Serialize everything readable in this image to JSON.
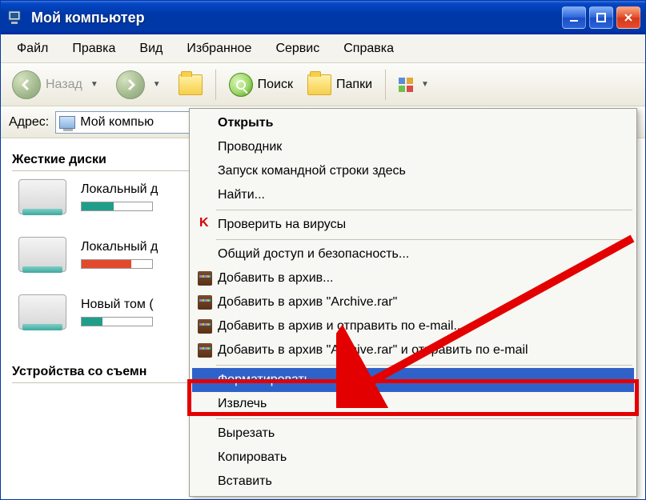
{
  "window": {
    "title": "Мой компьютер"
  },
  "menubar": [
    "Файл",
    "Правка",
    "Вид",
    "Избранное",
    "Сервис",
    "Справка"
  ],
  "toolbar": {
    "back_label": "Назад",
    "search_label": "Поиск",
    "folders_label": "Папки"
  },
  "addressbar": {
    "label": "Адрес:",
    "value": "Мой компью"
  },
  "content": {
    "section_hdd": "Жесткие диски",
    "section_removable": "Устройства со съемн",
    "drives": [
      {
        "label": "Локальный д",
        "fill_pct": 45,
        "fill_color": "#1f9e8a"
      },
      {
        "label": "Локальный д",
        "fill_pct": 70,
        "fill_color": "#e24a2b"
      },
      {
        "label": "Новый том (",
        "fill_pct": 30,
        "fill_color": "#1f9e8a"
      }
    ]
  },
  "context_menu": {
    "groups": [
      [
        {
          "label": "Открыть",
          "bold": true
        },
        {
          "label": "Проводник"
        },
        {
          "label": "Запуск командной строки здесь"
        },
        {
          "label": "Найти..."
        }
      ],
      [
        {
          "label": "Проверить на вирусы",
          "icon": "kaspersky"
        }
      ],
      [
        {
          "label": "Общий доступ и безопасность..."
        },
        {
          "label": "Добавить в архив...",
          "icon": "rar"
        },
        {
          "label": "Добавить в архив \"Archive.rar\"",
          "icon": "rar"
        },
        {
          "label": "Добавить в архив и отправить по e-mail...",
          "icon": "rar"
        },
        {
          "label": "Добавить в архив \"Archive.rar\" и отправить по e-mail",
          "icon": "rar"
        }
      ],
      [
        {
          "label": "Форматировать...",
          "selected": true
        },
        {
          "label": "Извлечь"
        }
      ],
      [
        {
          "label": "Вырезать"
        },
        {
          "label": "Копировать"
        },
        {
          "label": "Вставить"
        }
      ]
    ]
  }
}
